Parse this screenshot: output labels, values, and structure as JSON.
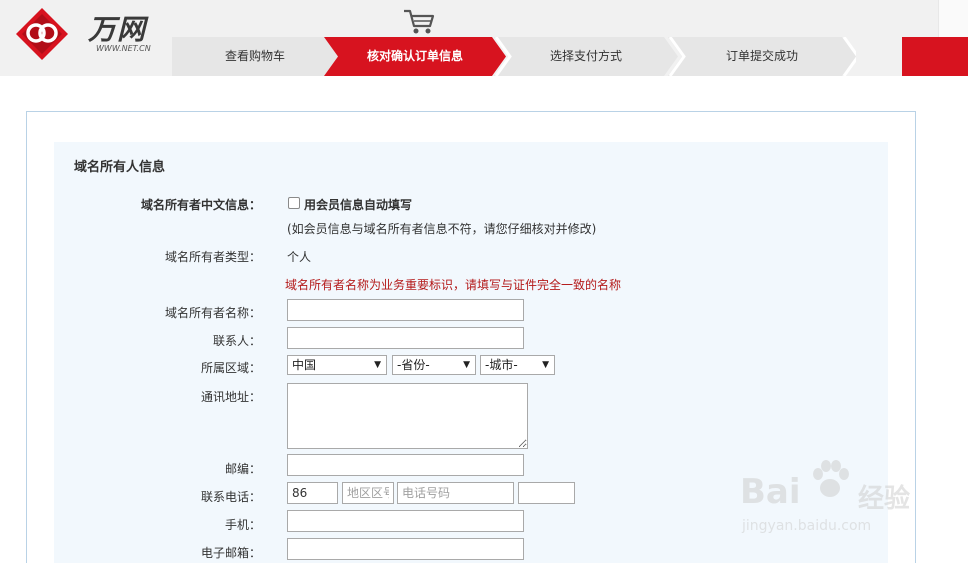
{
  "logo": {
    "name": "万网",
    "sub": "WWW.NET.CN"
  },
  "steps": [
    {
      "label": "查看购物车",
      "active": false
    },
    {
      "label": "核对确认订单信息",
      "active": true
    },
    {
      "label": "选择支付方式",
      "active": false
    },
    {
      "label": "订单提交成功",
      "active": false
    }
  ],
  "colors": {
    "accent": "#d7131f",
    "panel_border": "#b9d2e6",
    "panel_bg": "#f2f8fd",
    "hint": "#b41a1a"
  },
  "form": {
    "section_title": "域名所有人信息",
    "chinese_info_label": "域名所有者中文信息：",
    "autofill_label": "用会员信息自动填写",
    "autofill_checked": false,
    "autofill_hint": "(如会员信息与域名所有者信息不符，请您仔细核对并修改)",
    "owner_type_label": "域名所有者类型：",
    "owner_type_value": "个人",
    "owner_name_hint": "域名所有者名称为业务重要标识，请填写与证件完全一致的名称",
    "owner_name_label": "域名所有者名称：",
    "owner_name_value": "",
    "contact_label": "联系人：",
    "contact_value": "",
    "region_label": "所属区域：",
    "country_selected": "中国",
    "province_selected": "-省份-",
    "city_selected": "-城市-",
    "address_label": "通讯地址：",
    "address_value": "",
    "postcode_label": "邮编：",
    "postcode_value": "",
    "phone_label": "联系电话：",
    "phone_country_code": "86",
    "phone_area_placeholder": "地区区号",
    "phone_number_placeholder": "电话号码",
    "phone_ext_value": "",
    "mobile_label": "手机：",
    "mobile_value": "",
    "email_label": "电子邮箱：",
    "email_value": ""
  },
  "watermark": {
    "brand": "Bai",
    "brand_cn": "经验",
    "url": "jingyan.baidu.com"
  }
}
